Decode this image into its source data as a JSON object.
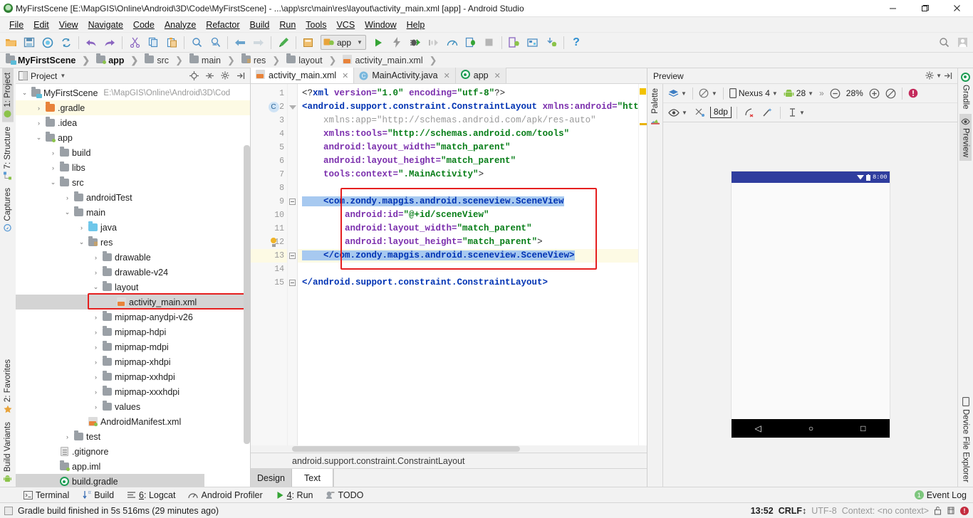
{
  "window": {
    "title": "MyFirstScene [E:\\MapGIS\\Online\\Android\\3D\\Code\\MyFirstScene] - ...\\app\\src\\main\\res\\layout\\activity_main.xml [app] - Android Studio",
    "minimize": "—",
    "maximize": "❐",
    "close": "✕"
  },
  "menu": [
    {
      "label": "File"
    },
    {
      "label": "Edit"
    },
    {
      "label": "View"
    },
    {
      "label": "Navigate"
    },
    {
      "label": "Code"
    },
    {
      "label": "Analyze"
    },
    {
      "label": "Refactor"
    },
    {
      "label": "Build"
    },
    {
      "label": "Run"
    },
    {
      "label": "Tools"
    },
    {
      "label": "VCS"
    },
    {
      "label": "Window"
    },
    {
      "label": "Help"
    }
  ],
  "toolbar": {
    "run_config": "app",
    "help_label": "?",
    "icons": [
      "open-folder-icon",
      "save-all-icon",
      "sync-project-icon",
      "refresh-icon",
      "undo-icon",
      "redo-icon",
      "cut-icon",
      "copy-icon",
      "paste-icon",
      "find-icon",
      "find-replace-icon",
      "back-icon",
      "forward-icon",
      "edit-icon",
      "compile-icon",
      "run-icon",
      "apply-changes-icon",
      "debug-icon",
      "step-icon",
      "profiler-icon",
      "attach-debugger-icon",
      "stop-icon",
      "avd-manager-icon",
      "sdk-manager-icon",
      "layout-inspector-icon",
      "help-icon",
      "search-everywhere-icon",
      "user-icon"
    ]
  },
  "breadcrumbs": [
    {
      "label": "MyFirstScene",
      "icon": "module-icon",
      "bold": true
    },
    {
      "label": "app",
      "icon": "app-module-icon",
      "bold": true
    },
    {
      "label": "src",
      "icon": "folder-icon",
      "bold": false
    },
    {
      "label": "main",
      "icon": "folder-icon",
      "bold": false
    },
    {
      "label": "res",
      "icon": "res-folder-icon",
      "bold": false
    },
    {
      "label": "layout",
      "icon": "folder-icon",
      "bold": false
    },
    {
      "label": "activity_main.xml",
      "icon": "xml-file-icon",
      "bold": false
    }
  ],
  "left_strip": [
    {
      "label": "1: Project",
      "icon": "project-icon",
      "active": true
    },
    {
      "label": "7: Structure",
      "icon": "structure-icon",
      "active": false
    },
    {
      "label": "Captures",
      "icon": "captures-icon",
      "active": false
    },
    {
      "label": "2: Favorites",
      "icon": "star-icon",
      "active": false
    },
    {
      "label": "Build Variants",
      "icon": "android-icon",
      "active": false
    }
  ],
  "right_strip": [
    {
      "label": "Gradle",
      "icon": "gradle-icon",
      "active": false
    },
    {
      "label": "Preview",
      "icon": "eye-icon",
      "active": true
    },
    {
      "label": "Device File Explorer",
      "icon": "device-icon",
      "active": false
    }
  ],
  "palette_strip": [
    {
      "label": "Palette",
      "icon": "palette-icon"
    }
  ],
  "project_panel": {
    "title": "Project",
    "actions": [
      "locate-icon",
      "collapse-all-icon",
      "settings-icon",
      "hide-icon"
    ],
    "tree": [
      {
        "indent": 0,
        "arrow": "⌄",
        "icon": "module-icon",
        "label": "MyFirstScene",
        "path": "E:\\MapGIS\\Online\\Android\\3D\\Cod",
        "state": "normal"
      },
      {
        "indent": 1,
        "arrow": "›",
        "icon": "folder-orange",
        "label": ".gradle",
        "path": "",
        "state": "yellow"
      },
      {
        "indent": 1,
        "arrow": "›",
        "icon": "folder-gray",
        "label": ".idea",
        "path": "",
        "state": "normal"
      },
      {
        "indent": 1,
        "arrow": "⌄",
        "icon": "app-module-icon",
        "label": "app",
        "path": "",
        "state": "normal"
      },
      {
        "indent": 2,
        "arrow": "›",
        "icon": "folder-gray",
        "label": "build",
        "path": "",
        "state": "normal"
      },
      {
        "indent": 2,
        "arrow": "›",
        "icon": "folder-gray",
        "label": "libs",
        "path": "",
        "state": "normal"
      },
      {
        "indent": 2,
        "arrow": "⌄",
        "icon": "folder-gray",
        "label": "src",
        "path": "",
        "state": "normal"
      },
      {
        "indent": 3,
        "arrow": "›",
        "icon": "folder-gray",
        "label": "androidTest",
        "path": "",
        "state": "normal"
      },
      {
        "indent": 3,
        "arrow": "⌄",
        "icon": "folder-gray",
        "label": "main",
        "path": "",
        "state": "normal"
      },
      {
        "indent": 4,
        "arrow": "›",
        "icon": "folder-blue",
        "label": "java",
        "path": "",
        "state": "normal"
      },
      {
        "indent": 4,
        "arrow": "⌄",
        "icon": "res-folder-icon",
        "label": "res",
        "path": "",
        "state": "normal"
      },
      {
        "indent": 5,
        "arrow": "›",
        "icon": "folder-gray",
        "label": "drawable",
        "path": "",
        "state": "normal"
      },
      {
        "indent": 5,
        "arrow": "›",
        "icon": "folder-gray",
        "label": "drawable-v24",
        "path": "",
        "state": "normal"
      },
      {
        "indent": 5,
        "arrow": "⌄",
        "icon": "folder-gray",
        "label": "layout",
        "path": "",
        "state": "normal"
      },
      {
        "indent": 6,
        "arrow": "",
        "icon": "xml-file-icon",
        "label": "activity_main.xml",
        "path": "",
        "state": "selected"
      },
      {
        "indent": 5,
        "arrow": "›",
        "icon": "folder-gray",
        "label": "mipmap-anydpi-v26",
        "path": "",
        "state": "normal"
      },
      {
        "indent": 5,
        "arrow": "›",
        "icon": "folder-gray",
        "label": "mipmap-hdpi",
        "path": "",
        "state": "normal"
      },
      {
        "indent": 5,
        "arrow": "›",
        "icon": "folder-gray",
        "label": "mipmap-mdpi",
        "path": "",
        "state": "normal"
      },
      {
        "indent": 5,
        "arrow": "›",
        "icon": "folder-gray",
        "label": "mipmap-xhdpi",
        "path": "",
        "state": "normal"
      },
      {
        "indent": 5,
        "arrow": "›",
        "icon": "folder-gray",
        "label": "mipmap-xxhdpi",
        "path": "",
        "state": "normal"
      },
      {
        "indent": 5,
        "arrow": "›",
        "icon": "folder-gray",
        "label": "mipmap-xxxhdpi",
        "path": "",
        "state": "normal"
      },
      {
        "indent": 5,
        "arrow": "›",
        "icon": "folder-gray",
        "label": "values",
        "path": "",
        "state": "normal"
      },
      {
        "indent": 4,
        "arrow": "",
        "icon": "manifest-file-icon",
        "label": "AndroidManifest.xml",
        "path": "",
        "state": "normal"
      },
      {
        "indent": 3,
        "arrow": "›",
        "icon": "folder-gray",
        "label": "test",
        "path": "",
        "state": "normal"
      },
      {
        "indent": 2,
        "arrow": "",
        "icon": "plain-file-icon",
        "label": ".gitignore",
        "path": "",
        "state": "normal"
      },
      {
        "indent": 2,
        "arrow": "",
        "icon": "app-module-icon",
        "label": "app.iml",
        "path": "",
        "state": "normal"
      },
      {
        "indent": 2,
        "arrow": "",
        "icon": "gradle-file-icon",
        "label": "build.gradle",
        "path": "",
        "state": "selected-dim"
      }
    ]
  },
  "editor": {
    "tabs": [
      {
        "label": "activity_main.xml",
        "icon": "xml-file-icon",
        "active": true,
        "close": "✕"
      },
      {
        "label": "MainActivity.java",
        "icon": "java-class-icon",
        "active": false,
        "close": "✕"
      },
      {
        "label": "app",
        "icon": "gradle-file-icon",
        "active": false,
        "close": "✕"
      }
    ],
    "status_breadcrumb": "android.support.constraint.ConstraintLayout",
    "design_text_tabs": [
      {
        "label": "Design",
        "active": false
      },
      {
        "label": "Text",
        "active": true
      }
    ],
    "lines": [
      {
        "n": 1,
        "gutter_mark": "",
        "fold": "",
        "current": false,
        "tokens": [
          {
            "t": "<?",
            "c": "t-pun"
          },
          {
            "t": "xml",
            "c": "t-tag"
          },
          {
            "t": " version=",
            "c": "t-attr"
          },
          {
            "t": "\"1.0\"",
            "c": "t-str"
          },
          {
            "t": " encoding=",
            "c": "t-attr"
          },
          {
            "t": "\"utf-8\"",
            "c": "t-str"
          },
          {
            "t": "?>",
            "c": "t-pun"
          }
        ]
      },
      {
        "n": 2,
        "gutter_mark": "class-badge",
        "fold": "tri",
        "current": false,
        "tokens": [
          {
            "t": "<android.support.constraint.ConstraintLayout",
            "c": "t-tag"
          },
          {
            "t": " xmlns:android=",
            "c": "t-attr"
          },
          {
            "t": "\"http://sche",
            "c": "t-str"
          }
        ]
      },
      {
        "n": 3,
        "gutter_mark": "",
        "fold": "",
        "current": false,
        "tokens": [
          {
            "t": "    xmlns:app=",
            "c": "t-dim"
          },
          {
            "t": "\"http://schemas.android.com/apk/res-auto\"",
            "c": "t-dim"
          }
        ]
      },
      {
        "n": 4,
        "gutter_mark": "",
        "fold": "",
        "current": false,
        "tokens": [
          {
            "t": "    xmlns:tools=",
            "c": "t-attr"
          },
          {
            "t": "\"http://schemas.android.com/tools\"",
            "c": "t-str"
          }
        ]
      },
      {
        "n": 5,
        "gutter_mark": "",
        "fold": "",
        "current": false,
        "tokens": [
          {
            "t": "    android:layout_width=",
            "c": "t-attr"
          },
          {
            "t": "\"match_parent\"",
            "c": "t-str"
          }
        ]
      },
      {
        "n": 6,
        "gutter_mark": "",
        "fold": "",
        "current": false,
        "tokens": [
          {
            "t": "    android:layout_height=",
            "c": "t-attr"
          },
          {
            "t": "\"match_parent\"",
            "c": "t-str"
          }
        ]
      },
      {
        "n": 7,
        "gutter_mark": "",
        "fold": "",
        "current": false,
        "tokens": [
          {
            "t": "    tools:context=",
            "c": "t-attr"
          },
          {
            "t": "\".MainActivity\"",
            "c": "t-str"
          },
          {
            "t": ">",
            "c": "t-pun"
          }
        ]
      },
      {
        "n": 8,
        "gutter_mark": "",
        "fold": "",
        "current": false,
        "tokens": []
      },
      {
        "n": 9,
        "gutter_mark": "",
        "fold": "box",
        "current": false,
        "selected": true,
        "tokens": [
          {
            "t": "    <com.zondy.mapgis.android.sceneview.SceneView",
            "c": "t-tag"
          }
        ]
      },
      {
        "n": 10,
        "gutter_mark": "",
        "fold": "",
        "current": false,
        "tokens": [
          {
            "t": "        android:id=",
            "c": "t-attr"
          },
          {
            "t": "\"@+id/sceneView\"",
            "c": "t-str"
          }
        ]
      },
      {
        "n": 11,
        "gutter_mark": "",
        "fold": "",
        "current": false,
        "tokens": [
          {
            "t": "        android:layout_width=",
            "c": "t-attr"
          },
          {
            "t": "\"match_parent\"",
            "c": "t-str"
          }
        ]
      },
      {
        "n": 12,
        "gutter_mark": "bulb",
        "fold": "",
        "current": false,
        "tokens": [
          {
            "t": "        android:layout_height=",
            "c": "t-attr"
          },
          {
            "t": "\"match_parent\"",
            "c": "t-str"
          },
          {
            "t": ">",
            "c": "t-pun"
          }
        ]
      },
      {
        "n": 13,
        "gutter_mark": "",
        "fold": "box",
        "current": true,
        "selected": true,
        "tokens": [
          {
            "t": "    </com.zondy.mapgis.android.sceneview.SceneView>",
            "c": "t-tag"
          }
        ]
      },
      {
        "n": 14,
        "gutter_mark": "",
        "fold": "",
        "current": false,
        "tokens": []
      },
      {
        "n": 15,
        "gutter_mark": "",
        "fold": "box",
        "current": false,
        "tokens": [
          {
            "t": "</android.support.constraint.ConstraintLayout>",
            "c": "t-tag"
          }
        ]
      }
    ]
  },
  "preview": {
    "title": "Preview",
    "header_actions": [
      "settings-icon",
      "hide-icon"
    ],
    "toolbar_row1": {
      "design_mode": "layers-icon",
      "orientation": "rotate-icon",
      "device": "Nexus 4",
      "api_level": "28",
      "overflow": "»",
      "zoom_out": "⊖",
      "zoom_value": "28%",
      "zoom_in": "⊕",
      "zoom_fit": "zoom-fit-icon",
      "issue_icon": "error-icon"
    },
    "toolbar_row2": {
      "eye": "eye-icon",
      "constraints": "constraints-off-icon",
      "margin": "8dp",
      "clear_constraints": "clear-constraints-icon",
      "infer_constraints": "magic-wand-icon",
      "guidelines": "guidelines-icon"
    },
    "device_screen": {
      "status_time": "8:00",
      "status_icons": [
        "wifi-icon",
        "battery-icon"
      ],
      "nav_buttons": [
        "back-icon",
        "home-icon",
        "recents-icon"
      ]
    }
  },
  "bottom_bar": [
    {
      "label": "Terminal",
      "icon": "terminal-icon"
    },
    {
      "label": "Build",
      "icon": "build-icon"
    },
    {
      "label": "6: Logcat",
      "icon": "logcat-icon"
    },
    {
      "label": "Android Profiler",
      "icon": "profiler-icon"
    },
    {
      "label": "4: Run",
      "icon": "run-icon"
    },
    {
      "label": "TODO",
      "icon": "todo-icon"
    }
  ],
  "event_log": {
    "label": "Event Log",
    "count": "1"
  },
  "status_bar": {
    "message": "Gradle build finished in 5s 516ms (29 minutes ago)",
    "time": "13:52",
    "line_separator": "CRLF↕",
    "encoding": "UTF-8",
    "context": "Context: <no context>",
    "icons": [
      "lock-icon",
      "inspection-icon",
      "error-icon"
    ]
  }
}
